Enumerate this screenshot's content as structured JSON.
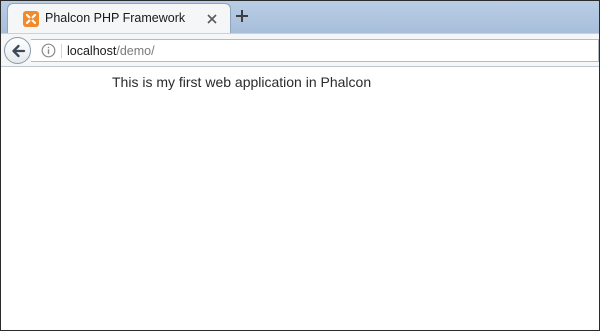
{
  "browser": {
    "tab": {
      "title": "Phalcon PHP Framework",
      "favicon": "xampp-logo-icon",
      "close_icon": "close-icon"
    },
    "new_tab_icon": "plus-icon",
    "nav": {
      "back_icon": "back-arrow-icon",
      "info_icon": "info-icon",
      "url_host": "localhost",
      "url_path": "/demo/"
    }
  },
  "page": {
    "text": "This is my first web application in Phalcon"
  },
  "colors": {
    "tab_strip": "#b9cde5",
    "favicon": "#f18a2b",
    "page_bg": "#ffffff"
  }
}
